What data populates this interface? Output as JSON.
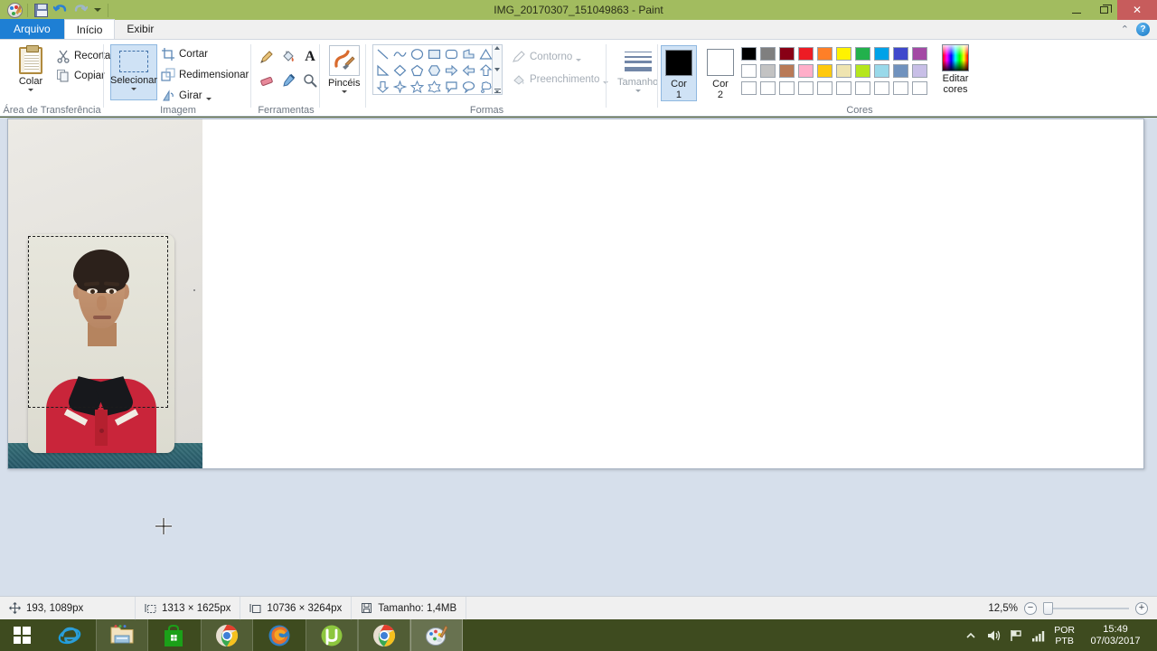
{
  "window": {
    "title": "IMG_20170307_151049863 - Paint",
    "quick_access": [
      {
        "name": "paint-logo",
        "label": "Paint"
      },
      {
        "name": "save-icon",
        "label": "Salvar"
      },
      {
        "name": "undo-icon",
        "label": "Desfazer"
      },
      {
        "name": "redo-icon",
        "label": "Refazer"
      },
      {
        "name": "customize-qat-icon",
        "label": "Personalizar Barra de Ferramentas de Acesso Rápido"
      }
    ],
    "controls": {
      "minimize": "–",
      "restore": "❐",
      "close": "✕"
    },
    "titlebar_color": "#a2bc5f",
    "close_color": "#c75c5c"
  },
  "tabs": {
    "file": "Arquivo",
    "items": [
      {
        "label": "Início",
        "active": true
      },
      {
        "label": "Exibir",
        "active": false
      }
    ],
    "collapse_ribbon": "⌃",
    "help": "?"
  },
  "ribbon": {
    "clipboard": {
      "group_label": "Área de Transferência",
      "paste": "Colar",
      "cut": "Recortar",
      "copy": "Copiar"
    },
    "image": {
      "group_label": "Imagem",
      "select": "Selecionar",
      "crop": "Cortar",
      "resize": "Redimensionar",
      "rotate": "Girar"
    },
    "tools": {
      "group_label": "Ferramentas",
      "items": [
        {
          "name": "pencil-icon",
          "label": "Lápis"
        },
        {
          "name": "fill-bucket-icon",
          "label": "Preencher com cor"
        },
        {
          "name": "text-icon",
          "label": "Texto"
        },
        {
          "name": "eraser-icon",
          "label": "Borracha"
        },
        {
          "name": "color-picker-icon",
          "label": "Seletor de Cores"
        },
        {
          "name": "magnifier-icon",
          "label": "Lupa"
        }
      ]
    },
    "brushes": {
      "group_label": "",
      "label": "Pincéis"
    },
    "shapes": {
      "group_label": "Formas",
      "outline": "Contorno",
      "fill": "Preenchimento",
      "gallery": [
        "line",
        "curve",
        "oval",
        "rectangle",
        "rounded-rectangle",
        "polygon",
        "triangle",
        "right-triangle",
        "diamond",
        "pentagon",
        "hexagon",
        "right-arrow",
        "left-arrow",
        "up-arrow",
        "down-arrow",
        "four-point-star",
        "five-point-star",
        "six-point-star",
        "rounded-callout",
        "oval-callout",
        "cloud-callout"
      ]
    },
    "size": {
      "group_label": "",
      "label": "Tamanho"
    },
    "colors": {
      "group_label": "Cores",
      "color1_label_top": "Cor",
      "color1_label_bottom": "1",
      "color2_label_top": "Cor",
      "color2_label_bottom": "2",
      "color1_value": "#000000",
      "color2_value": "#ffffff",
      "edit_colors_line1": "Editar",
      "edit_colors_line2": "cores",
      "palette_row1": [
        "#000000",
        "#7f7f7f",
        "#880015",
        "#ed1c24",
        "#ff7f27",
        "#fff200",
        "#22b14c",
        "#00a2e8",
        "#3f48cc",
        "#a349a4"
      ],
      "palette_row2": [
        "#ffffff",
        "#c3c3c3",
        "#b97a57",
        "#ffaec9",
        "#ffc90e",
        "#efe4b0",
        "#b5e61d",
        "#99d9ea",
        "#7092be",
        "#c8bfe7"
      ],
      "palette_row3": [
        "#ffffff",
        "#ffffff",
        "#ffffff",
        "#ffffff",
        "#ffffff",
        "#ffffff",
        "#ffffff",
        "#ffffff",
        "#ffffff",
        "#ffffff"
      ]
    }
  },
  "canvas": {
    "selection_active": true,
    "cursor": "crosshair"
  },
  "statusbar": {
    "cursor_position": "193, 1089px",
    "selection_size": "1313 × 1625px",
    "image_size": "10736 × 3264px",
    "file_size": "Tamanho: 1,4MB",
    "zoom_level": "12,5%",
    "zoom_out": "−",
    "zoom_in": "+"
  },
  "taskbar": {
    "start": "start-button",
    "items": [
      {
        "name": "internet-explorer-icon",
        "label": "Internet Explorer",
        "active": false,
        "framed": false
      },
      {
        "name": "file-explorer-icon",
        "label": "Explorador de Arquivos",
        "active": false,
        "framed": true
      },
      {
        "name": "store-icon",
        "label": "Loja",
        "active": false,
        "framed": false
      },
      {
        "name": "chrome-icon",
        "label": "Google Chrome",
        "active": false,
        "framed": true
      },
      {
        "name": "firefox-icon",
        "label": "Mozilla Firefox",
        "active": false,
        "framed": false
      },
      {
        "name": "utorrent-icon",
        "label": "µTorrent",
        "active": false,
        "framed": true
      },
      {
        "name": "chrome-icon-2",
        "label": "Google Chrome",
        "active": false,
        "framed": true
      },
      {
        "name": "paint-taskbar-icon",
        "label": "Paint",
        "active": true,
        "framed": true
      }
    ],
    "tray": {
      "show_hidden": "▲",
      "volume": "volume-icon",
      "action_center": "flag-icon",
      "network": "signal-icon",
      "language_line1": "POR",
      "language_line2": "PTB",
      "time": "15:49",
      "date": "07/03/2017"
    }
  }
}
